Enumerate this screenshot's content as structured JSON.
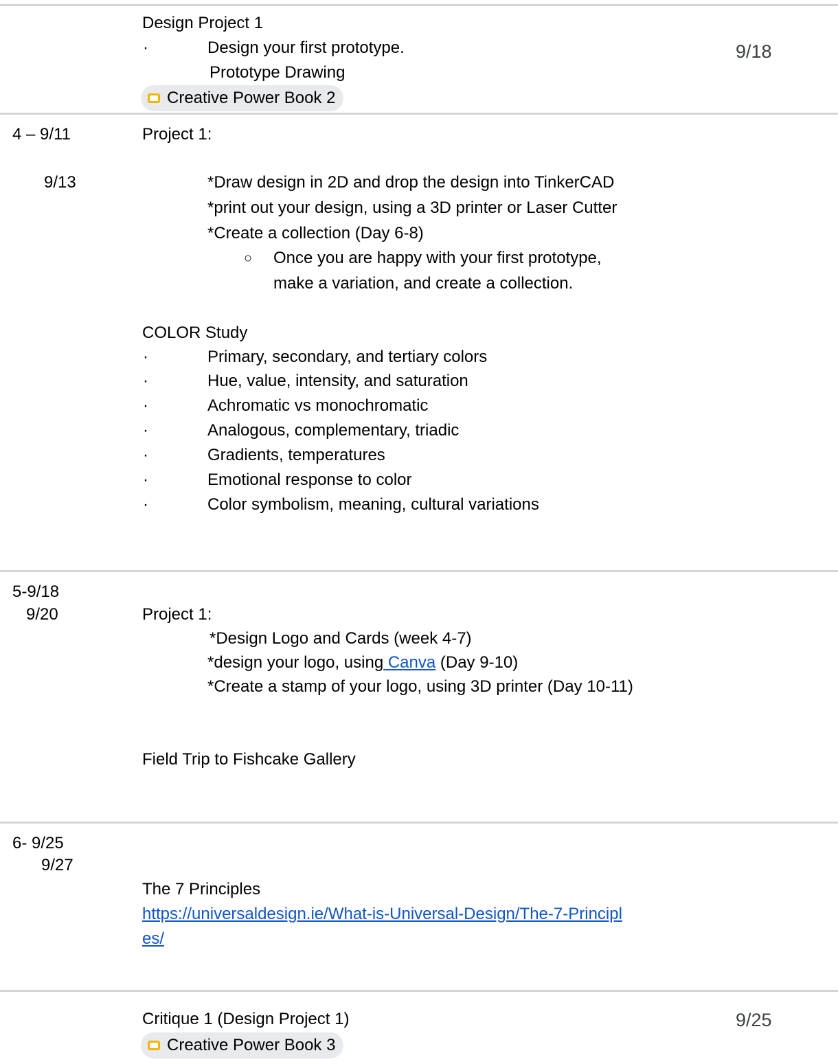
{
  "rows": {
    "design_project": {
      "title": "Design Project 1",
      "bullet": "·",
      "task": "Design your first prototype.",
      "sub": "Prototype Drawing",
      "chip": "Creative Power Book 2",
      "due": "9/18"
    },
    "week4": {
      "week": "4 – 9/11",
      "date2": "9/13",
      "heading": "Project 1:",
      "items": [
        "*Draw design in 2D and drop the design into TinkerCAD",
        "*print out your design, using a 3D printer or Laser Cutter",
        "*Create a collection (Day 6-8)"
      ],
      "sub_bullet": "○",
      "sub_item_line1": "Once you are happy with your first prototype,",
      "sub_item_line2": "make a variation, and create a collection.",
      "color_heading": "COLOR Study",
      "bullet": "·",
      "color_items": [
        "Primary, secondary, and tertiary colors",
        "Hue, value, intensity, and saturation",
        "Achromatic vs monochromatic",
        "Analogous, complementary, triadic",
        "Gradients, temperatures",
        "Emotional response to color",
        "Color symbolism, meaning, cultural variations"
      ]
    },
    "week5": {
      "week": "5-9/18",
      "date2": "9/20",
      "heading": "Project 1:",
      "item1": "*Design Logo and Cards (week 4-7)",
      "item2_prefix": "*design your logo, using",
      "item2_link": " Canva",
      "item2_suffix": " (Day 9-10)",
      "item3": "*Create a stamp of your logo, using 3D printer (Day 10-11)",
      "field_trip": "Field Trip to Fishcake Gallery"
    },
    "week6": {
      "week": "6-  9/25",
      "date2": "9/27",
      "heading": "The 7 Principles",
      "link_line1": "https://universaldesign.ie/What-is-Universal-Design/The-7-Principl",
      "link_line2": "es/"
    },
    "critique": {
      "title": "Critique 1 (Design Project 1)",
      "chip": "Creative Power Book 3",
      "due": "9/25"
    }
  },
  "colors": {
    "link": "#1155cc",
    "chip_bg": "#e8eaed",
    "slides_icon": "#f4b400",
    "divider": "#d5d5d5"
  },
  "icons": {
    "chip": "google-slides-icon"
  }
}
